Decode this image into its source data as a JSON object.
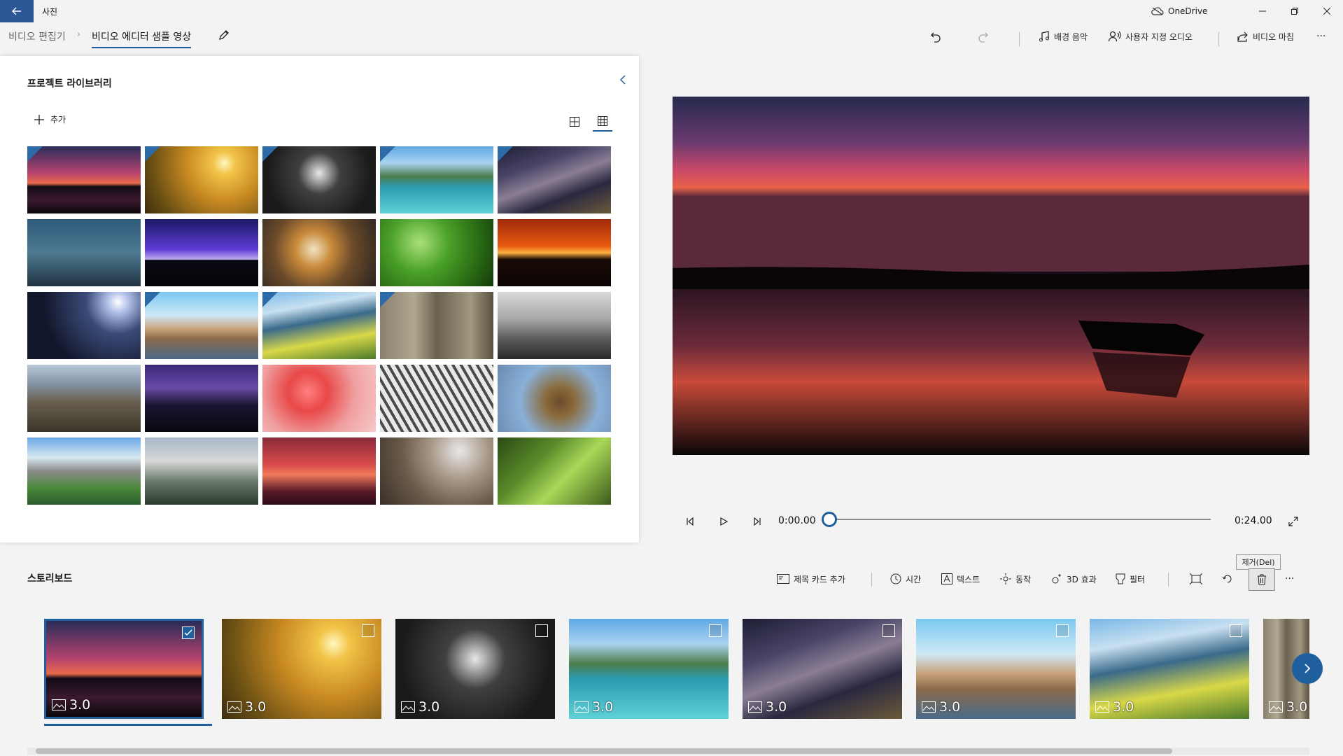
{
  "titlebar": {
    "app_title": "사진",
    "onedrive_label": "OneDrive"
  },
  "breadcrumb": {
    "root": "비디오 편집기",
    "separator": "›",
    "current": "비디오 에디터 샘플 영상"
  },
  "toolbar": {
    "background_music": "배경 음악",
    "custom_audio": "사용자 지정 오디오",
    "finish_video": "비디오 마침",
    "more": "···"
  },
  "library": {
    "title": "프로젝트 라이브러리",
    "add_label": "추가"
  },
  "player": {
    "current_time": "0:00.00",
    "total_time": "0:24.00",
    "progress": 0
  },
  "storyboard": {
    "title": "스토리보드",
    "add_title_card": "제목 카드 추가",
    "duration": "시간",
    "text": "텍스트",
    "motion": "동작",
    "effects_3d": "3D 효과",
    "filters": "필터",
    "remove_tooltip": "제거(Del)",
    "more": "···"
  },
  "clip_duration": "3.0",
  "colors": {
    "accent": "#1f5f9e",
    "back_button": "#2b5797",
    "badge": "#2d6aa8"
  }
}
